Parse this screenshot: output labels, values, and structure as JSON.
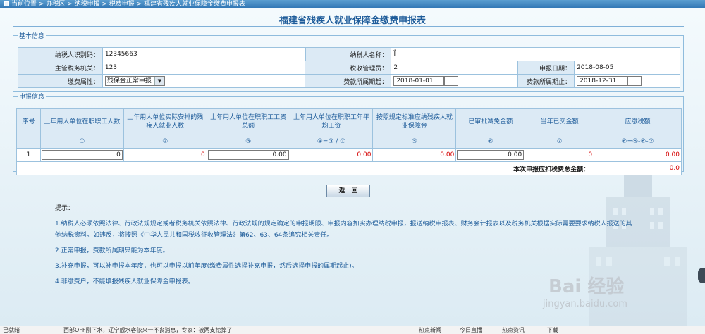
{
  "breadcrumb": {
    "text": "当前位置 > 办税区 > 纳税申报 > 税费申报 > 福建省残疾人就业保障金缴费申报表"
  },
  "title": "福建省残疾人就业保障金缴费申报表",
  "basic": {
    "legend": "基本信息",
    "taxpayer_id_label": "纳税人识别码：",
    "taxpayer_id": "12345663",
    "taxpayer_name_label": "纳税人名称：",
    "taxpayer_name": "Ḯ",
    "authority_label": "主管税务机关：",
    "authority": "123",
    "manager_label": "税收管理员：",
    "manager": "2",
    "apply_date_label": "申报日期：",
    "apply_date": "2018-08-05",
    "fee_type_label": "缴费属性：",
    "fee_type": "残保金正常申报",
    "period_start_label": "费款所属期起：",
    "period_start": "2018-01-01",
    "period_end_label": "费款所属期止：",
    "period_end": "2018-12-31",
    "date_btn": "..."
  },
  "declare": {
    "legend": "申报信息",
    "headers": [
      "序号",
      "上年用人单位在职职工人数",
      "上年用人单位实际安排的残疾人就业人数",
      "上年用人单位在职职工工资总额",
      "上年用人单位在职职工年平均工资",
      "按照规定标准应纳残疾人就业保障金",
      "已审批减免金额",
      "当年已交金额",
      "应缴税额"
    ],
    "formulas": [
      "",
      "①",
      "②",
      "③",
      "④=③ / ①",
      "⑤",
      "⑥",
      "⑦",
      "⑧=⑤-⑥-⑦"
    ],
    "row": {
      "seq": "1",
      "employees": "0",
      "disabled_employees": "0",
      "wage_total": "0.00",
      "avg_wage": "0.00",
      "should_pay": "0.00",
      "reduction": "0.00",
      "paid": "0",
      "tax_due": "0.00"
    },
    "total_label": "本次申报应扣税费总金额：",
    "total_value": "0.0"
  },
  "buttons": {
    "return": "返　回"
  },
  "notes": {
    "title": "提示：",
    "items": [
      "1.纳税人必须依照法律、行政法规规定或者税务机关依照法律、行政法规的规定确定的申报期限、申报内容如实办理纳税申报，报送纳税申报表、财务会计报表以及税务机关根据实际需要要求纳税人报送的其他纳税资料。如违反，将按照《中华人民共和国税收征收管理法》第62、63、64条追究相关责任。",
      "2.正常申报，费款所属期只能为本年度。",
      "3.补充申报，可以补申报本年度，也可以申报以前年度(缴费属性选择补充申报，然后选择申报的属期起止)。",
      "4.非缴费户，不能填报残疾人就业保障金申报表。"
    ]
  },
  "watermark": {
    "brand": "Bai 经验",
    "url": "jingyan.baidu.com"
  },
  "statusbar": {
    "left": "已就绪",
    "news": "西部OFF刚下水，辽宁舰水客依来一不丧消息，专家：被两支挖掉了",
    "item1": "热点新闻",
    "item2": "今日直播",
    "item3": "热点资讯",
    "item4": "下载"
  }
}
